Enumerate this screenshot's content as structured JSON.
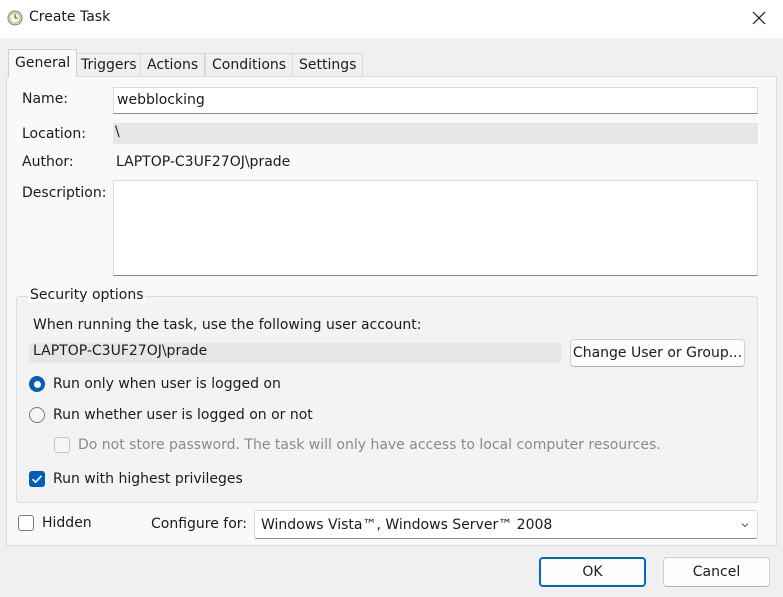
{
  "window": {
    "title": "Create Task",
    "icon": "clock-icon",
    "close_icon": "close-icon"
  },
  "tabs": [
    {
      "label": "General",
      "active": true
    },
    {
      "label": "Triggers"
    },
    {
      "label": "Actions"
    },
    {
      "label": "Conditions"
    },
    {
      "label": "Settings"
    }
  ],
  "general": {
    "name_label": "Name:",
    "name_value": "webblocking",
    "location_label": "Location:",
    "location_value": "\\",
    "author_label": "Author:",
    "author_value": "LAPTOP-C3UF27OJ\\prade",
    "description_label": "Description:",
    "description_value": ""
  },
  "security": {
    "group_label": "Security options",
    "account_prompt": "When running the task, use the following user account:",
    "account_value": "LAPTOP-C3UF27OJ\\prade",
    "change_button": "Change User or Group...",
    "radio_logged_on": {
      "label": "Run only when user is logged on",
      "selected": true
    },
    "radio_whether": {
      "label": "Run whether user is logged on or not",
      "selected": false
    },
    "no_store_password": {
      "label": "Do not store password.  The task will only have access to local computer resources.",
      "checked": false,
      "enabled": false
    },
    "highest_privileges": {
      "label": "Run with highest privileges",
      "checked": true
    }
  },
  "hidden": {
    "label": "Hidden",
    "checked": false
  },
  "configure": {
    "label": "Configure for:",
    "selected": "Windows Vista™, Windows Server™ 2008"
  },
  "buttons": {
    "ok": "OK",
    "cancel": "Cancel"
  },
  "colors": {
    "accent": "#005fb8",
    "window_bg": "#f0f0f0",
    "panel_bg": "#f9f9f9"
  }
}
